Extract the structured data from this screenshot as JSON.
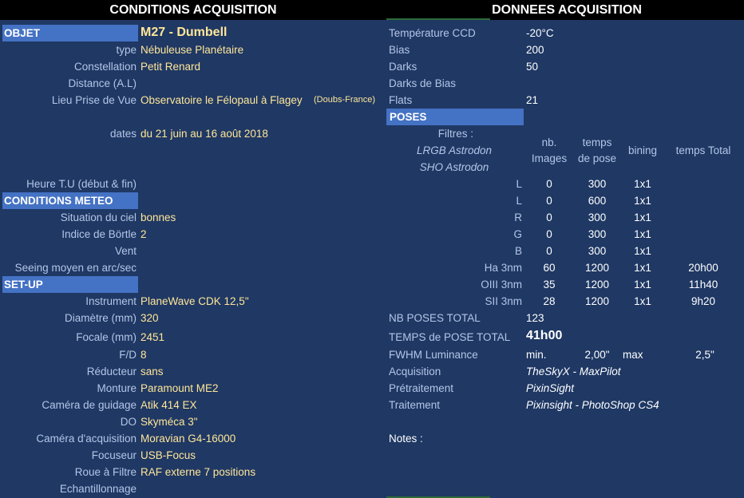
{
  "headers": {
    "left": "CONDITIONS ACQUISITION",
    "right": "DONNEES ACQUISITION"
  },
  "left": {
    "objet_label": "OBJET",
    "objet_value": "M27 - Dumbell",
    "rows": [
      {
        "label": "type",
        "value": "Nébuleuse Planétaire"
      },
      {
        "label": "Constellation",
        "value": "Petit Renard"
      },
      {
        "label": "Distance (A.L)",
        "value": ""
      },
      {
        "label": "Lieu Prise de Vue",
        "value": "Observatoire le Félopaul à Flagey",
        "extra": "(Doubs-France)"
      },
      {
        "label": "dates",
        "value": "du 21 juin au 16 août 2018"
      },
      {
        "label": "Heure T.U (début & fin)",
        "value": ""
      }
    ],
    "meteo_label": "CONDITIONS METEO",
    "meteo_rows": [
      {
        "label": "Situation du ciel",
        "value": "bonnes"
      },
      {
        "label": "Indice de Börtle",
        "value": "2"
      },
      {
        "label": "Vent",
        "value": ""
      },
      {
        "label": "Seeing moyen en arc/sec",
        "value": ""
      }
    ],
    "setup_label": "SET-UP",
    "setup_rows": [
      {
        "label": "Instrument",
        "value": "PlaneWave CDK 12,5\""
      },
      {
        "label": "Diamètre (mm)",
        "value": "320"
      },
      {
        "label": "Focale (mm)",
        "value": "2451"
      },
      {
        "label": "F/D",
        "value": "8"
      },
      {
        "label": "Réducteur",
        "value": "sans"
      },
      {
        "label": "Monture",
        "value": "Paramount ME2"
      },
      {
        "label": "Caméra de guidage",
        "value": "Atik 414 EX"
      },
      {
        "label": "DO",
        "value": "Skyméca 3\""
      },
      {
        "label": "Caméra d'acquisition",
        "value": "Moravian G4-16000"
      },
      {
        "label": "Focuseur",
        "value": "USB-Focus"
      },
      {
        "label": "Roue à Filtre",
        "value": "RAF externe 7 positions"
      },
      {
        "label": "Echantillonnage",
        "value": ""
      }
    ]
  },
  "right": {
    "top_rows": [
      {
        "label": "Température CCD",
        "value": "-20°C"
      },
      {
        "label": "Bias",
        "value": "200"
      },
      {
        "label": "Darks",
        "value": "50"
      },
      {
        "label": "Darks de Bias",
        "value": ""
      },
      {
        "label": "Flats",
        "value": "21"
      }
    ],
    "poses_label": "POSES",
    "filtres_label": "Filtres :",
    "filtres_line1": "LRGB Astrodon",
    "filtres_line2": "SHO Astrodon",
    "col_nb1": "nb.",
    "col_nb2": "Images",
    "col_temps1": "temps",
    "col_temps2": "de pose",
    "col_bining": "bining",
    "col_total": "temps Total",
    "poses": [
      {
        "filter": "L",
        "nb": "0",
        "temps": "300",
        "bin": "1x1",
        "total": ""
      },
      {
        "filter": "L",
        "nb": "0",
        "temps": "600",
        "bin": "1x1",
        "total": ""
      },
      {
        "filter": "R",
        "nb": "0",
        "temps": "300",
        "bin": "1x1",
        "total": ""
      },
      {
        "filter": "G",
        "nb": "0",
        "temps": "300",
        "bin": "1x1",
        "total": ""
      },
      {
        "filter": "B",
        "nb": "0",
        "temps": "300",
        "bin": "1x1",
        "total": ""
      },
      {
        "filter": "Ha 3nm",
        "nb": "60",
        "temps": "1200",
        "bin": "1x1",
        "total": "20h00"
      },
      {
        "filter": "OIII 3nm",
        "nb": "35",
        "temps": "1200",
        "bin": "1x1",
        "total": "11h40"
      },
      {
        "filter": "SII 3nm",
        "nb": "28",
        "temps": "1200",
        "bin": "1x1",
        "total": "9h20"
      }
    ],
    "nb_poses_label": "NB POSES TOTAL",
    "nb_poses_value": "123",
    "temps_pose_label": "TEMPS de POSE TOTAL",
    "temps_pose_value": "41h00",
    "fwhm_label": "FWHM Luminance",
    "fwhm_min_label": "min.",
    "fwhm_min": "2,00\"",
    "fwhm_max_label": "max",
    "fwhm_max": "2,5\"",
    "soft_rows": [
      {
        "label": "Acquisition",
        "value": "TheSkyX - MaxPilot"
      },
      {
        "label": "Prétraitement",
        "value": "PixinSight"
      },
      {
        "label": "Traitement",
        "value": "Pixinsight - PhotoShop CS4"
      }
    ],
    "notes_label": "Notes :"
  }
}
